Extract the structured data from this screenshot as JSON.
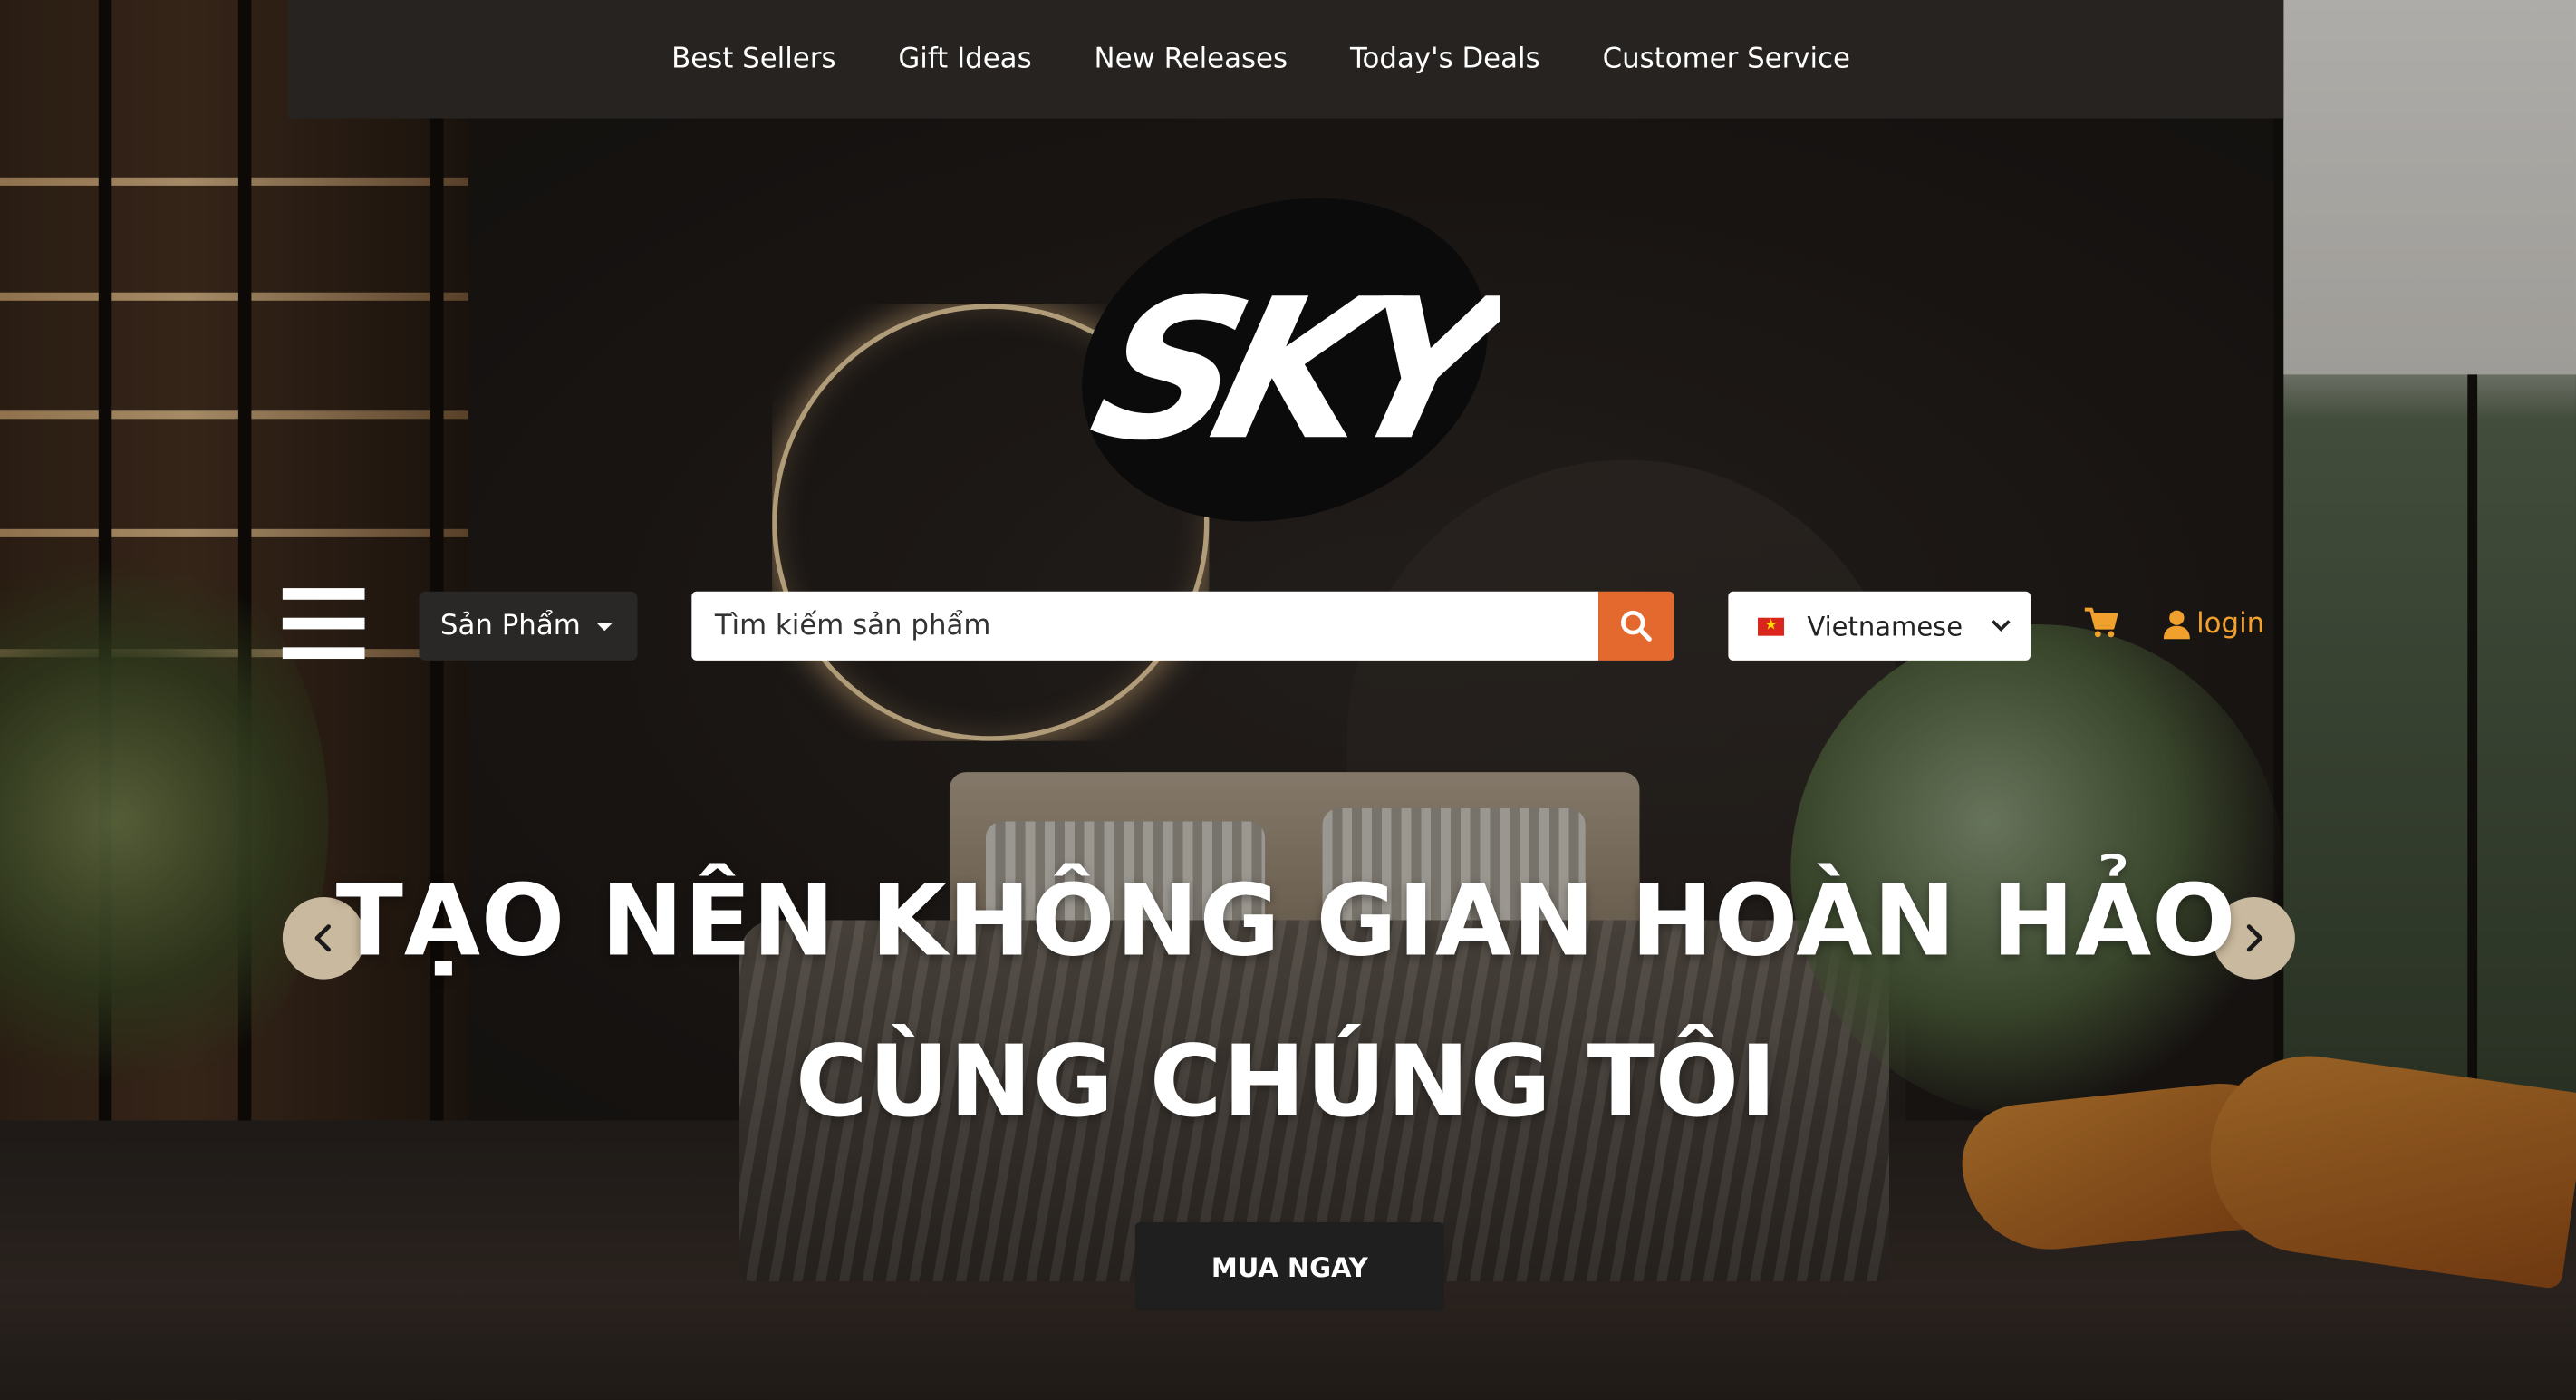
{
  "topnav": {
    "links": [
      "Best Sellers",
      "Gift Ideas",
      "New Releases",
      "Today's Deals",
      "Customer Service"
    ]
  },
  "brand": {
    "logo_text": "SKY"
  },
  "toolbar": {
    "category_label": "Sản Phẩm",
    "search": {
      "value": "Tìm kiếm sản phẩm",
      "placeholder": "Tìm kiếm sản phẩm"
    },
    "language": "Vietnamese",
    "login_label": "login"
  },
  "hero": {
    "title_line1": "TẠO NÊN KHÔNG GIAN HOÀN HẢO",
    "title_line2": "CÙNG CHÚNG TÔI",
    "cta_label": "MUA NGAY"
  },
  "icons": [
    "menu-icon",
    "caret-down-icon",
    "search-icon",
    "vietnam-flag-icon",
    "chevron-down-icon",
    "cart-icon",
    "user-icon",
    "chevron-left-icon",
    "chevron-right-icon"
  ],
  "colors": {
    "accent_orange": "#e4692e",
    "login_orange": "#f0a02c",
    "nav_bg": "#262321",
    "arrow_bg": "#c9b99e",
    "cta_bg": "#1f1f1f"
  }
}
